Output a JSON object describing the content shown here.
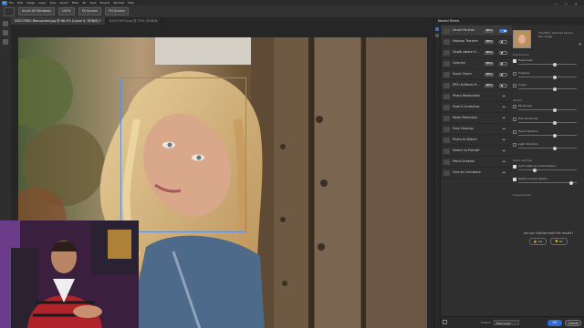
{
  "menubar": {
    "logo": "Ps",
    "items": [
      "File",
      "Edit",
      "Image",
      "Layer",
      "Type",
      "Select",
      "Filter",
      "3D",
      "View",
      "Plugins",
      "Window",
      "Help"
    ]
  },
  "options": {
    "btn1": "Scroll All Windows",
    "btn2": "100%",
    "btn3": "Fit Screen",
    "btn4": "Fill Screen"
  },
  "tabs": [
    {
      "label": "DSC07850-Retouched.jpg @ 66.4% (Layer 0, RGB/8) *"
    },
    {
      "label": "DSC07873.jpg @ 25% (RGB/8)"
    }
  ],
  "panel": {
    "title": "Neural Filters",
    "filters": [
      {
        "name": "Smart Portrait",
        "badge": "BETA",
        "on": true
      },
      {
        "name": "Makeup Transfer",
        "badge": "BETA",
        "on": false
      },
      {
        "name": "Depth-Aware H...",
        "badge": "BETA",
        "on": false
      },
      {
        "name": "Colorize",
        "badge": "BETA",
        "on": false
      },
      {
        "name": "Super Zoom",
        "badge": "BETA",
        "on": false
      },
      {
        "name": "JPEG Artifacts R...",
        "badge": "BETA",
        "on": false
      },
      {
        "name": "Photo Restoration",
        "badge": "",
        "on": false
      },
      {
        "name": "Dust & Scratches",
        "badge": "",
        "on": false
      },
      {
        "name": "Noise Reduction",
        "badge": "",
        "on": false
      },
      {
        "name": "Face Cleanup",
        "badge": "",
        "on": false
      },
      {
        "name": "Photo to Sketch",
        "badge": "",
        "on": false
      },
      {
        "name": "Sketch to Portrait",
        "badge": "",
        "on": false
      },
      {
        "name": "Pencil Artwork",
        "badge": "",
        "on": false
      },
      {
        "name": "Face to Caricature",
        "badge": "",
        "on": false
      }
    ],
    "preview_caption": "The filter selected face in the image",
    "add_symbol": "+",
    "section_expressions": "Expressions",
    "section_global": "Global",
    "section_settings": "Mode settings",
    "section_experimental": "Experimental",
    "sliders": [
      {
        "label": "Happiness",
        "checked": true,
        "pos": 0.62,
        "val": "0"
      },
      {
        "label": "Surprise",
        "checked": false,
        "pos": 0.62,
        "val": "0"
      },
      {
        "label": "Anger",
        "checked": false,
        "pos": 0.62,
        "val": "0"
      },
      {
        "label": "Facial age",
        "checked": false,
        "pos": 0.62,
        "val": "0"
      },
      {
        "label": "Hair thickness",
        "checked": false,
        "pos": 0.62,
        "val": "0"
      },
      {
        "label": "Head direction",
        "checked": false,
        "pos": 0.62,
        "val": "0"
      },
      {
        "label": "Light direction",
        "checked": false,
        "pos": 0.62,
        "val": "0"
      },
      {
        "label": "Auto balance combinations",
        "checked": true,
        "pos": 0.28,
        "val": "0"
      },
      {
        "label": "Retain unique details",
        "checked": true,
        "pos": 0.9,
        "val": "0"
      }
    ],
    "feedback_question": "Are you satisfied with the results?",
    "yes": "Yes",
    "no": "No"
  },
  "footer": {
    "output_label": "Output",
    "output_value": "New Layer",
    "ok": "OK",
    "cancel": "Cancel"
  },
  "colors": {
    "accent": "#3a78ea"
  }
}
